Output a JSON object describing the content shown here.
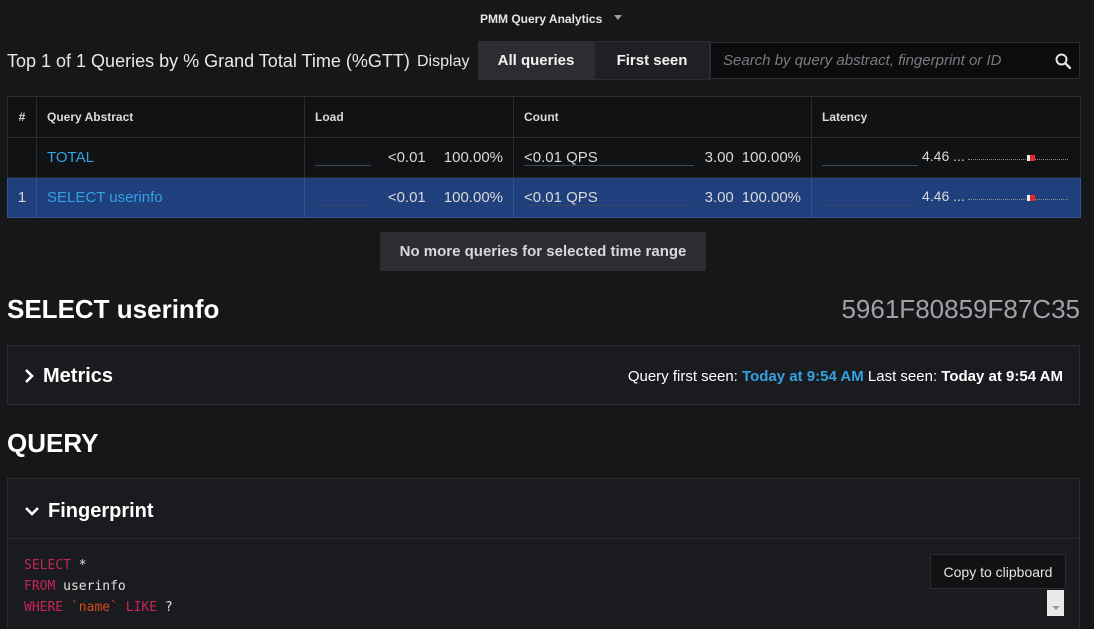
{
  "app": {
    "title": "PMM Query Analytics"
  },
  "toolbar": {
    "heading": "Top 1 of 1 Queries by % Grand Total Time (%GTT)",
    "display_label": "Display",
    "tabs": [
      {
        "label": "All queries",
        "active": true
      },
      {
        "label": "First seen",
        "active": false
      }
    ],
    "search_placeholder": "Search by query abstract, fingerprint or ID"
  },
  "table": {
    "columns": [
      "#",
      "Query Abstract",
      "Load",
      "Count",
      "Latency"
    ],
    "rows": [
      {
        "num": "",
        "abstract": "TOTAL",
        "load": "<0.01",
        "load_pct": "100.00%",
        "qps": "<0.01 QPS",
        "count": "3.00",
        "count_pct": "100.00%",
        "latency": "4.46 ...",
        "selected": false
      },
      {
        "num": "1",
        "abstract": "SELECT userinfo",
        "load": "<0.01",
        "load_pct": "100.00%",
        "qps": "<0.01 QPS",
        "count": "3.00",
        "count_pct": "100.00%",
        "latency": "4.46 ...",
        "selected": true
      }
    ]
  },
  "no_more": "No more queries for selected time range",
  "query": {
    "title": "SELECT userinfo",
    "id": "5961F80859F87C35"
  },
  "metrics": {
    "label": "Metrics",
    "first_seen_label": "Query first seen:",
    "first_seen_value": "Today at 9:54 AM",
    "last_seen_label": "Last seen:",
    "last_seen_value": "Today at 9:54 AM"
  },
  "section": {
    "title": "QUERY"
  },
  "fingerprint": {
    "label": "Fingerprint",
    "code": [
      {
        "kw": "SELECT",
        "rest": " *"
      },
      {
        "kw": "FROM",
        "rest": " userinfo"
      },
      {
        "kw": "WHERE",
        "str": "`name`",
        "kw2": "LIKE",
        "rest": " ?"
      }
    ],
    "copy_label": "Copy to clipboard"
  },
  "colors": {
    "background": "#161719",
    "accent": "#33a2e5",
    "selected_row": "#1f3f7d",
    "keyword": "#c8255a",
    "string": "#d64b1f"
  }
}
